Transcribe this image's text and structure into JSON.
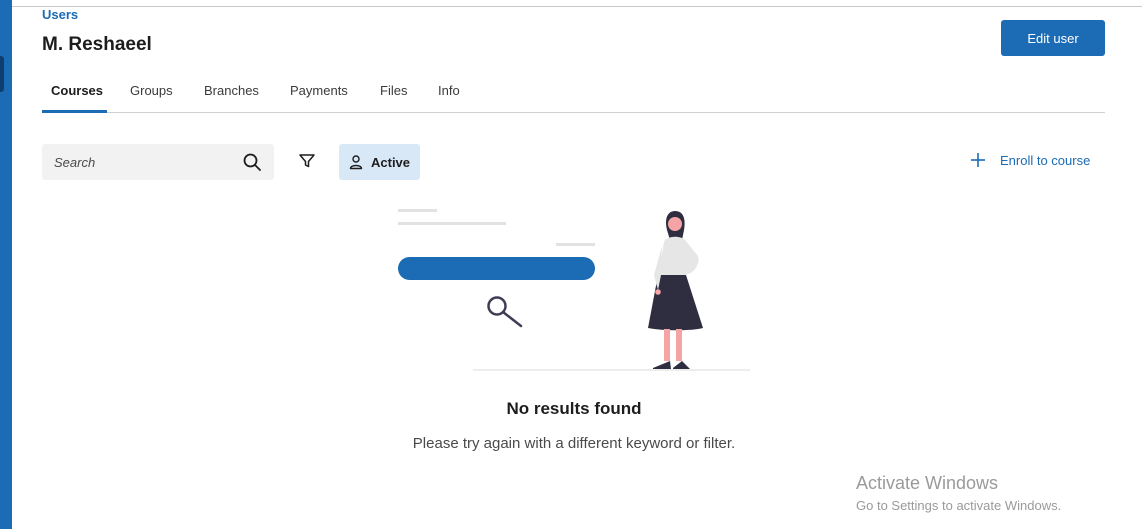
{
  "header": {
    "breadcrumb": "Users",
    "title": "M. Reshaeel",
    "edit_button": "Edit user"
  },
  "tabs": [
    {
      "label": "Courses",
      "active": true
    },
    {
      "label": "Groups"
    },
    {
      "label": "Branches"
    },
    {
      "label": "Payments"
    },
    {
      "label": "Files"
    },
    {
      "label": "Info"
    }
  ],
  "toolbar": {
    "search_placeholder": "Search",
    "search_icon": "search-icon",
    "filter_icon": "filter-icon",
    "status_chip": "Active",
    "status_icon": "user-icon",
    "enroll_label": "Enroll to course",
    "enroll_icon": "plus-icon"
  },
  "empty_state": {
    "title": "No results found",
    "message": "Please try again with a different keyword or filter."
  },
  "watermark": {
    "title": "Activate Windows",
    "subtitle": "Go to Settings to activate Windows."
  },
  "colors": {
    "accent": "#1b6bb5",
    "chip_bg": "#d9e8f7",
    "search_bg": "#f2f2f2"
  }
}
